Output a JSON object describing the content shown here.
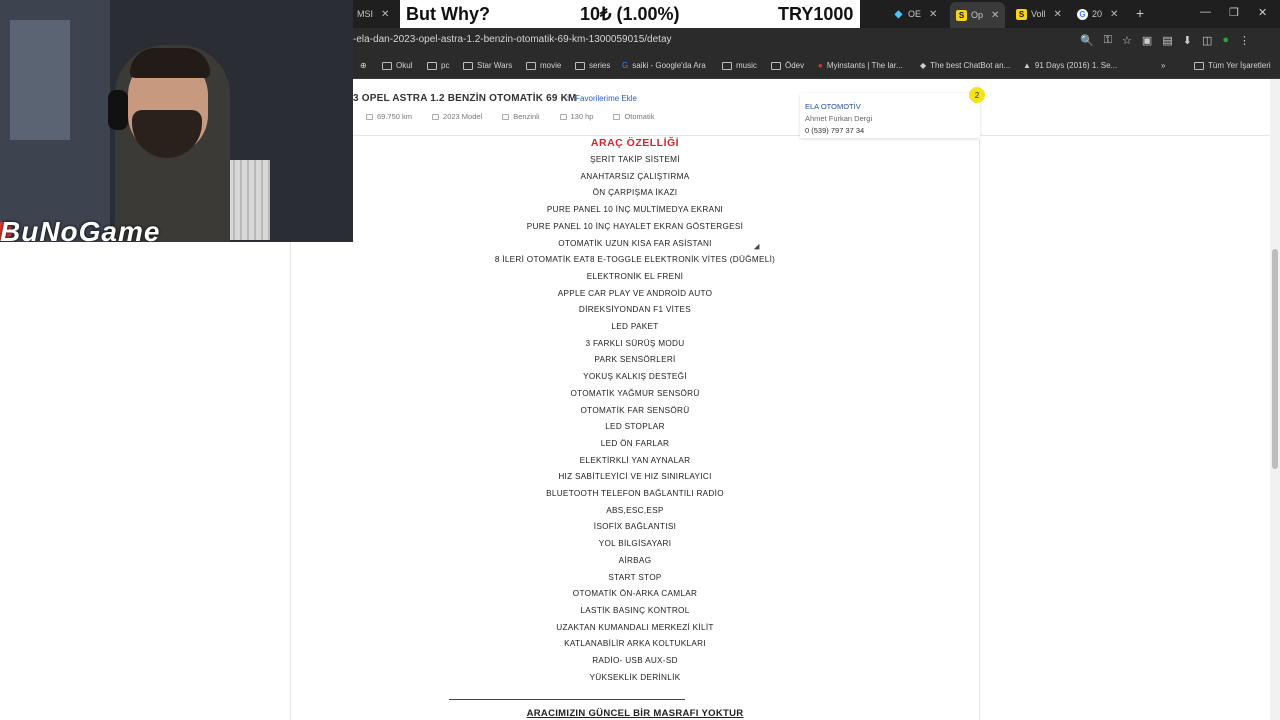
{
  "tabs": [
    {
      "label": "MSI"
    },
    {
      "label": "OE"
    },
    {
      "label": "Op"
    },
    {
      "label": "Voll"
    },
    {
      "label": "20"
    }
  ],
  "browser": {
    "url": "-ela-dan-2023-opel-astra-1.2-benzin-otomatik-69-km-1300059015/detay"
  },
  "bookmarks": [
    "Okul",
    "pc",
    "Star Wars",
    "movie",
    "series",
    "saiki - Google'da Ara",
    "music",
    "Ödev",
    "Myinstants | The lar...",
    "The best ChatBot an...",
    "91 Days (2016) 1. Se...",
    "Tüm Yer İşaretleri"
  ],
  "overlay": {
    "brand": "BuNoGame",
    "ticker_title": "But Why?",
    "ticker_amount": "10₺ (1.00%)",
    "ticker_goal": "TRY1000"
  },
  "listing": {
    "title": "3 OPEL ASTRA 1.2 BENZİN OTOMATİK 69 KM",
    "favorite_label": "Favorilerime Ekle",
    "specs": [
      "69.750 km",
      "2023 Model",
      "Benzinli",
      "130 hp",
      "Otomatik"
    ]
  },
  "dealer": {
    "name": "ELA OTOMOTİV",
    "person": "Ahmet Furkan Dergi",
    "phone": "0 (539) 797 37 34",
    "badge": "2"
  },
  "features": {
    "title": "ARAÇ ÖZELLİĞİ",
    "items": [
      "ŞERİT TAKİP SİSTEMİ",
      "ANAHTARSIZ ÇALIŞTIRMA",
      "ÖN ÇARPIŞMA İKAZI",
      "PURE PANEL 10 İNÇ MULTİMEDYA EKRANI",
      "PURE PANEL 10 İNÇ HAYALET EKRAN GÖSTERGESİ",
      "OTOMATİK UZUN KISA FAR ASİSTANI",
      "8 İLERİ OTOMATİK EAT8 E-TOGGLE ELEKTRONİK VİTES (DÜĞMELİ)",
      "ELEKTRONİK EL FRENİ",
      "APPLE CAR PLAY VE ANDROİD AUTO",
      "DİREKSİYONDAN F1 VİTES",
      "LED PAKET",
      "3 FARKLI SÜRÜŞ MODU",
      "PARK SENSÖRLERİ",
      "YOKUŞ KALKIŞ DESTEĞİ",
      "OTOMATİK YAĞMUR SENSÖRÜ",
      "OTOMATİK FAR SENSÖRÜ",
      "LED STOPLAR",
      "LED ÖN FARLAR",
      "ELEKTİRKLİ YAN AYNALAR",
      "HIZ SABİTLEYİCİ VE HIZ SINIRLAYICI",
      "BLUETOOTH TELEFON BAĞLANTILI RADİO",
      "ABS,ESC,ESP",
      "İSOFİX BAĞLANTISI",
      "YOL BİLGİSAYARI",
      "AİRBAG",
      "START STOP",
      "OTOMATİK ÖN-ARKA CAMLAR",
      "LASTİK BASINÇ KONTROL",
      "UZAKTAN KUMANDALI MERKEZİ KİLİT",
      "KATLANABİLİR ARKA KOLTUKLARI",
      "RADİO- USB AUX-SD",
      "YÜKSEKLİK DERİNLİK"
    ],
    "expense_note": "ARACIMIZIN GÜNCEL BİR MASRAFI YOKTUR"
  }
}
